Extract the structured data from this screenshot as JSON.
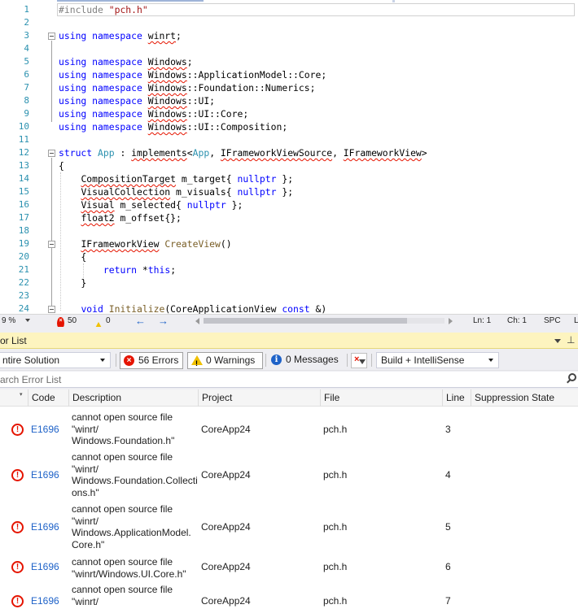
{
  "editor": {
    "line_numbers": [
      "1",
      "2",
      "3",
      "4",
      "5",
      "6",
      "7",
      "8",
      "9",
      "10",
      "11",
      "12",
      "13",
      "14",
      "15",
      "16",
      "17",
      "18",
      "19",
      "20",
      "21",
      "22",
      "23",
      "24"
    ],
    "status": {
      "zoom": "9 %",
      "errors": "50",
      "warnings": "0",
      "back_arrow": "←",
      "forward_arrow": "→",
      "ln": "Ln: 1",
      "ch": "Ch: 1",
      "mode": "SPC",
      "crlf": "L"
    }
  },
  "error_list": {
    "title": "or List",
    "scope": "ntire Solution",
    "errors_btn": "56 Errors",
    "warnings_btn": "0 Warnings",
    "messages_btn": "0 Messages",
    "build_filter": "Build + IntelliSense",
    "search_placeholder": "arch Error List",
    "columns": {
      "code": "Code",
      "description": "Description",
      "project": "Project",
      "file": "File",
      "line": "Line",
      "suppression": "Suppression State"
    },
    "rows": [
      {
        "code": "E1696",
        "description": "cannot open source file\n\"winrt/\nWindows.Foundation.h\"",
        "project": "CoreApp24",
        "file": "pch.h",
        "line": "3"
      },
      {
        "code": "E1696",
        "description": "cannot open source file\n\"winrt/\nWindows.Foundation.Collecti\nons.h\"",
        "project": "CoreApp24",
        "file": "pch.h",
        "line": "4"
      },
      {
        "code": "E1696",
        "description": "cannot open source file\n\"winrt/\nWindows.ApplicationModel.\nCore.h\"",
        "project": "CoreApp24",
        "file": "pch.h",
        "line": "5"
      },
      {
        "code": "E1696",
        "description": "cannot open source file\n\"winrt/Windows.UI.Core.h\"",
        "project": "CoreApp24",
        "file": "pch.h",
        "line": "6"
      },
      {
        "code": "E1696",
        "description": "cannot open source file\n\"winrt/\nWindows.UI.Composition.h\"",
        "project": "CoreApp24",
        "file": "pch.h",
        "line": "7"
      }
    ]
  }
}
